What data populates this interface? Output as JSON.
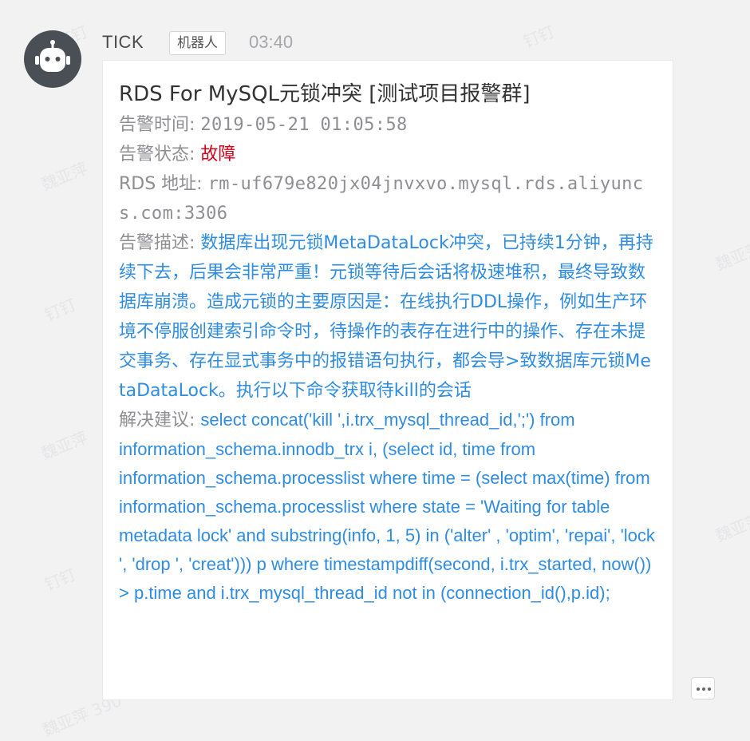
{
  "watermarks": {
    "dingding": "钉钉",
    "name": "魏亚萍",
    "name_num": "魏亚萍 390"
  },
  "message": {
    "sender": "TICK",
    "badge": "机器人",
    "time": "03:40",
    "avatar_icon": "robot-icon",
    "title": "RDS For MySQL元锁冲突 [测试项目报警群]",
    "alert_time_label": "告警时间: ",
    "alert_time_value": "2019-05-21 01:05:58",
    "alert_status_label": "告警状态: ",
    "alert_status_value": "故障",
    "rds_address_label": "RDS 地址: ",
    "rds_address_value": "rm-uf679e820jx04jnvxvo.mysql.rds.aliyuncs.com:3306",
    "description_label": "告警描述: ",
    "description_value": "数据库出现元锁MetaDataLock冲突，已持续1分钟，再持续下去，后果会非常严重！元锁等待后会话将极速堆积，最终导致数据库崩溃。造成元锁的主要原因是：在线执行DDL操作，例如生产环境不停服创建索引命令时，待操作的表存在进行中的操作、存在未提交事务、存在显式事务中的报错语句执行，都会导>致数据库元锁MetaDataLock。执行以下命令获取待kill的会话",
    "suggestion_label": "解决建议: ",
    "suggestion_value": "select concat('kill ',i.trx_mysql_thread_id,';') from information_schema.innodb_trx i, (select id, time from information_schema.processlist where time = (select max(time) from information_schema.processlist where state = 'Waiting for table metadata lock' and substring(info, 1, 5) in ('alter' , 'optim', 'repai', 'lock ', 'drop ', 'creat'))) p where timestampdiff(second, i.trx_started, now()) > p.time and i.trx_mysql_thread_id not in (connection_id(),p.id);"
  },
  "colors": {
    "background": "#f2f2f3",
    "avatar": "#4a4f56",
    "link_blue": "#2f8ce0",
    "fault_red": "#d9001b",
    "label_gray": "#8e8e93"
  },
  "more_button_icon": "more-dots-icon"
}
